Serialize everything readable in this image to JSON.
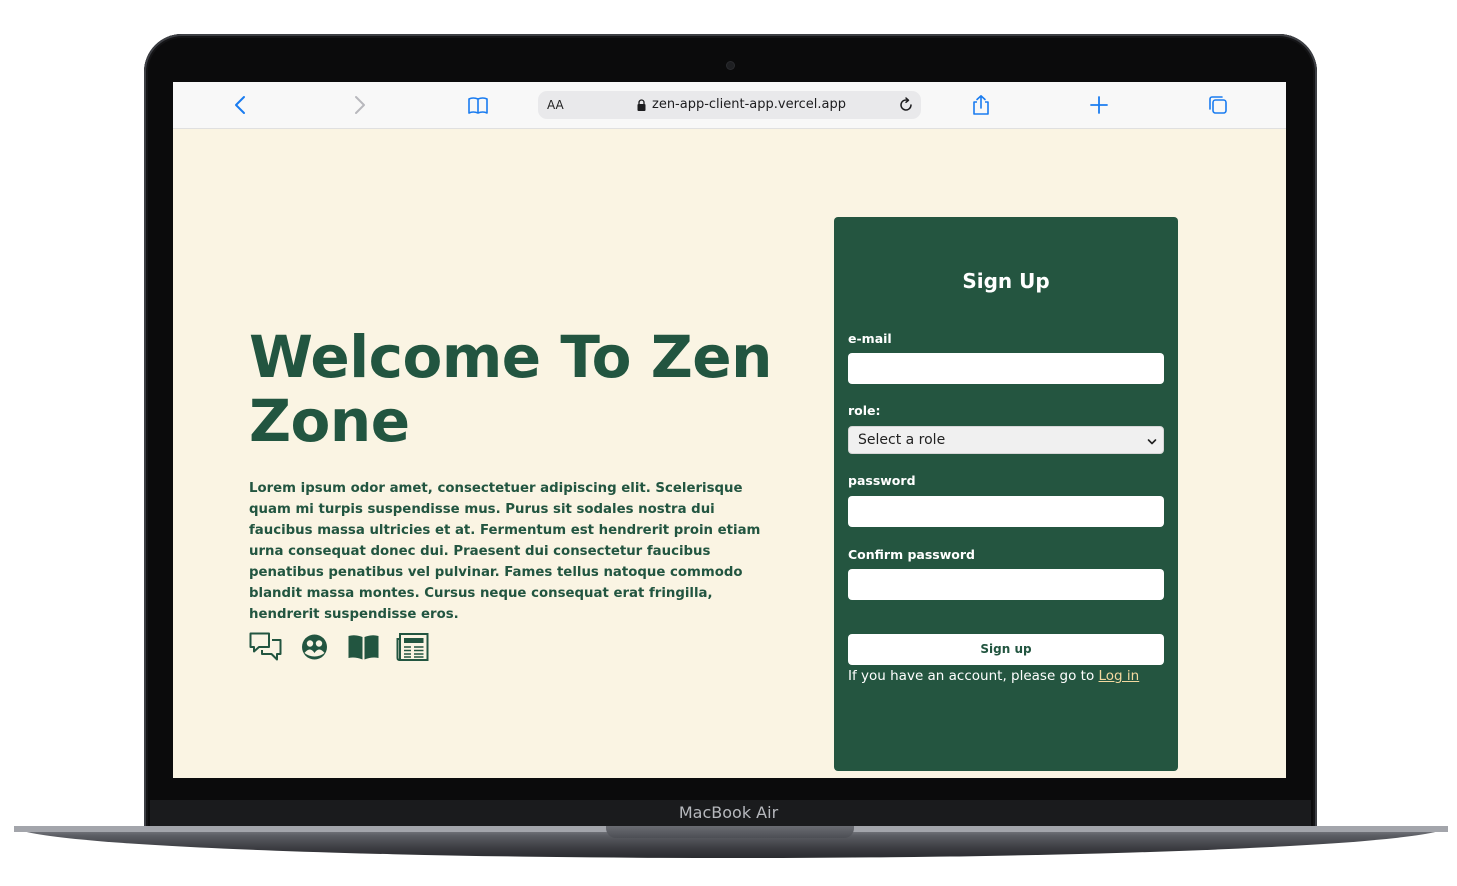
{
  "device": {
    "label": "MacBook Air"
  },
  "browser": {
    "reader_label": "AA",
    "url": "zen-app-client-app.vercel.app",
    "icons": [
      "back-icon",
      "forward-icon",
      "bookmarks-icon",
      "lock-icon",
      "reload-icon",
      "share-icon",
      "new-tab-icon",
      "tabs-icon"
    ]
  },
  "hero": {
    "title": "Welcome To Zen Zone",
    "body": "Lorem ipsum odor amet, consectetuer adipiscing elit. Scelerisque quam mi turpis suspendisse mus. Purus sit sodales nostra dui faucibus massa ultricies et at. Fermentum est hendrerit proin etiam urna consequat donec dui. Praesent dui consectetur faucibus penatibus penatibus vel pulvinar. Fames tellus natoque commodo blandit massa montes. Cursus neque consequat erat fringilla, hendrerit suspendisse eros.",
    "feature_icons": [
      "chat-icon",
      "community-icon",
      "book-icon",
      "newspaper-icon"
    ]
  },
  "signup": {
    "title": "Sign Up",
    "email_label": "e-mail",
    "email_value": "",
    "role_label": "role:",
    "role_selected": "Select a role",
    "password_label": "password",
    "password_value": "",
    "confirm_label": "Confirm password",
    "confirm_value": "",
    "submit_label": "Sign up",
    "login_prompt": "If you have an account, please go to ",
    "login_link": "Log in"
  },
  "colors": {
    "accent": "#225540",
    "page_background": "#faf4e3",
    "link": "#f3d9a0",
    "browser_blue": "#1a7cf0"
  }
}
